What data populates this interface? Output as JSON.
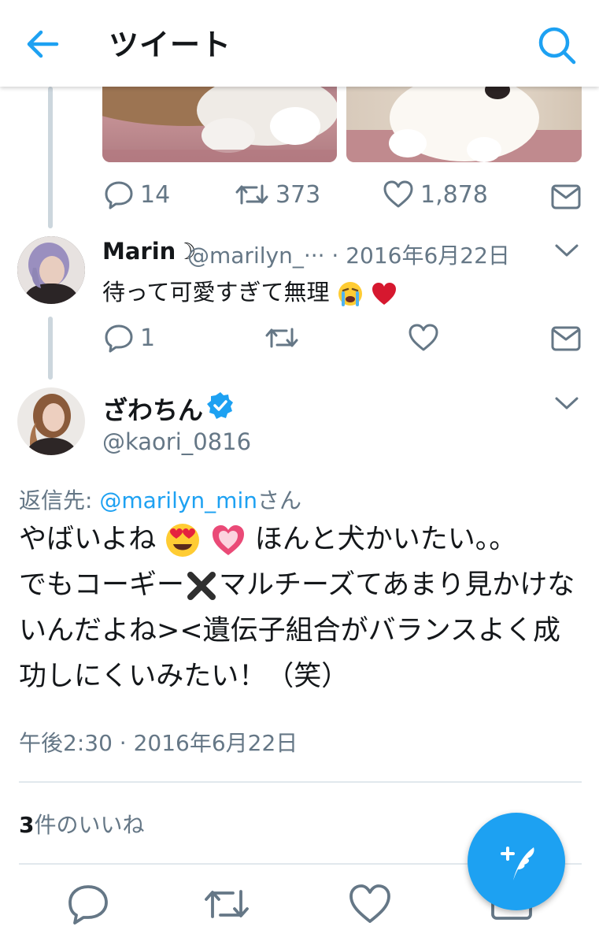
{
  "header": {
    "title": "ツイート"
  },
  "prev_tweet": {
    "reply_count": "14",
    "retweet_count": "373",
    "like_count": "1,878"
  },
  "reply_tweet": {
    "name": "Marin☽",
    "meta": "@marilyn_··· · 2016年6月22日",
    "text": "待って可愛すぎて無理",
    "reply_count": "1"
  },
  "main_tweet": {
    "name": "ざわちん",
    "handle": "@kaori_0816",
    "reply_to_prefix": "返信先: ",
    "reply_to_user": "@marilyn_min",
    "reply_to_suffix": "さん",
    "text_part1": "やばいよね",
    "text_part2": " ほんと犬かいたい。。",
    "text_part3": "でもコーギー",
    "text_part4": "マルチーズてあまり見かけないんだよね><遺伝子組合がバランスよく成功しにくいみたい！（笑）",
    "timestamp": "午後2:30 · 2016年6月22日",
    "likes_count": "3",
    "likes_label": "件のいいね"
  },
  "colors": {
    "accent": "#1da1f2",
    "text": "#14171a",
    "secondary": "#657786",
    "divider": "#e1e8ed"
  },
  "icons": [
    "back-arrow-icon",
    "search-icon",
    "reply-icon",
    "retweet-icon",
    "like-icon",
    "dm-icon",
    "chevron-down-icon",
    "verified-badge-icon",
    "compose-icon"
  ]
}
